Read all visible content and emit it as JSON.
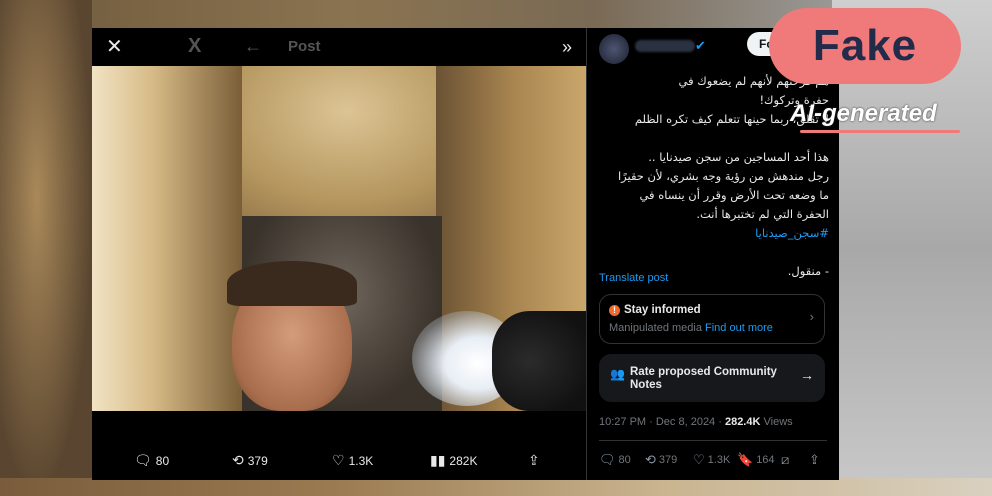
{
  "media": {
    "close_icon": "close-icon",
    "x_logo": "X",
    "back_icon": "arrow-left-icon",
    "title": "Post",
    "expand_icon": "chevron-double-right-icon"
  },
  "media_actions": {
    "replies": "80",
    "reposts": "379",
    "likes": "1.3K",
    "views": "282K"
  },
  "post": {
    "follow_label": "Fo",
    "lines_1": [
      "هم فرحتهم لأنهم لم يضعوك في",
      "حفرة وتركوك!",
      "لا تقلق، ربما حينها تتعلم كيف تكره الظلم"
    ],
    "lines_2": [
      "هذا أحد المساجين من سجن صيدنايا ..",
      "رجل مندهش من رؤية وجه بشري، لأن حقيرًا",
      "ما وضعه تحت الأرض وقرر أن ينساه في",
      "الحفرة التي لم تختبرها أنت."
    ],
    "hashtag": "#سجن_صيدنايا",
    "source": "- منقول.",
    "translate": "Translate post"
  },
  "stay_informed": {
    "title": "Stay informed",
    "sub": "Manipulated media",
    "link": "Find out more"
  },
  "community_notes": {
    "title": "Rate proposed Community Notes"
  },
  "meta": {
    "time": "10:27 PM · Dec 8, 2024 · ",
    "views_num": "282.4K",
    "views_label": " Views"
  },
  "panel_actions": {
    "replies": "80",
    "reposts": "379",
    "likes": "1.3K",
    "bookmarks": "164"
  },
  "overlay": {
    "fake": "Fake",
    "ai": "AI-generated"
  },
  "colors": {
    "accent": "#1d9bf0",
    "badge": "#f07a7a",
    "warning": "#f4692a"
  }
}
